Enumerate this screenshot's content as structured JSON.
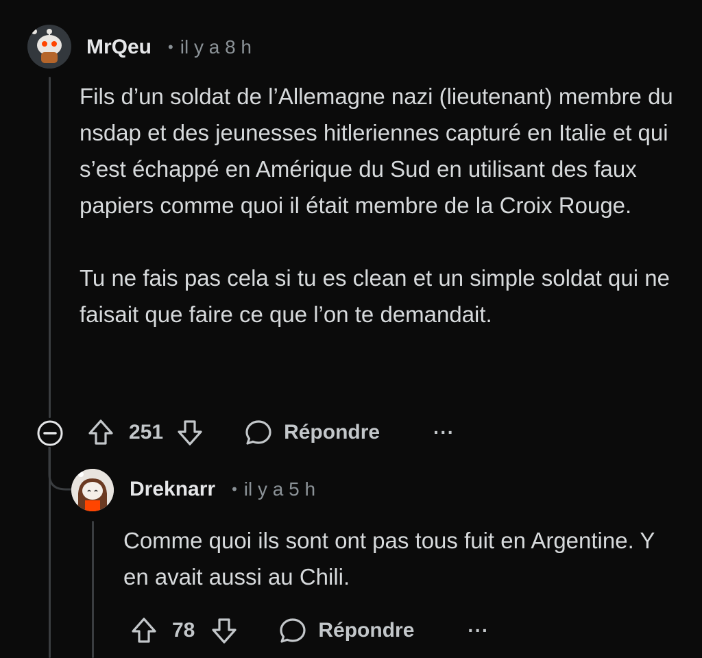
{
  "comments": [
    {
      "author": "MrQeu",
      "dot": "•",
      "time": "il y a 8 h",
      "paragraphs": [
        "Fils d’un soldat de l’Allemagne nazi (lieutenant) membre du nsdap et des jeunesses hitleriennes capturé en Italie et qui s’est échappé en Amérique du Sud en utilisant des faux papiers comme quoi il était membre de la Croix Rouge.",
        "Tu ne fais pas cela si tu es clean et un simple soldat qui ne faisait que faire ce que l’on te demandait."
      ],
      "votes": "251",
      "reply_label": "Répondre",
      "more": "···"
    },
    {
      "author": "Dreknarr",
      "dot": "•",
      "time": "il y a 5 h",
      "paragraphs": [
        "Comme quoi ils sont ont pas tous fuit en Argentine. Y en avait aussi au Chili."
      ],
      "votes": "78",
      "reply_label": "Répondre",
      "more": "···"
    }
  ],
  "colors": {
    "background": "#0b0b0b",
    "text": "#d7dadc",
    "muted": "#8b9297",
    "thread_line": "#3a3d40"
  },
  "icons": [
    "collapse-icon",
    "upvote-icon",
    "downvote-icon",
    "reply-bubble-icon",
    "more-options-icon"
  ]
}
